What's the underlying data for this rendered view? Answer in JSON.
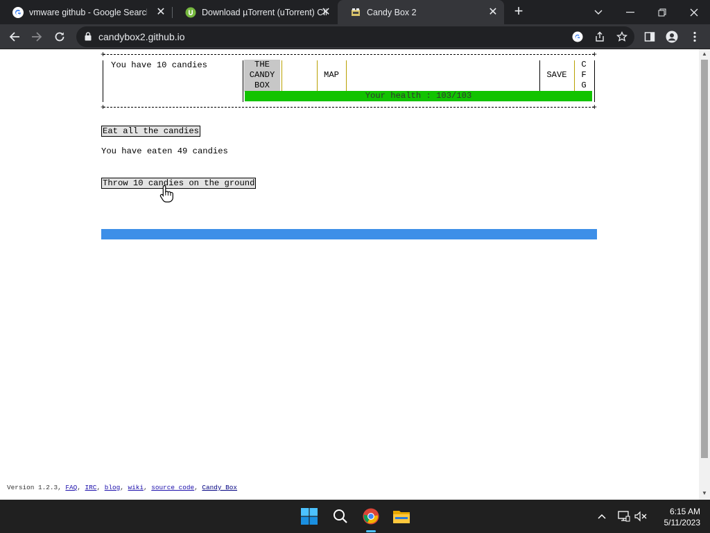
{
  "browser": {
    "tabs": [
      {
        "title": "vmware github - Google Search",
        "icon": "google-icon"
      },
      {
        "title": "Download µTorrent (uTorrent) Cli",
        "icon": "utorrent-icon"
      },
      {
        "title": "Candy Box 2",
        "icon": "candybox-icon"
      }
    ],
    "active_tab": 2,
    "new_tab": "+",
    "url": "candybox2.github.io"
  },
  "game": {
    "candies_text": "You have 10 candies",
    "menu": {
      "candy_box": [
        "THE",
        "CANDY",
        "BOX"
      ],
      "map": "MAP",
      "save": "SAVE",
      "cfg": [
        "C",
        "F",
        "G"
      ]
    },
    "health_text": "Your health : 103/103",
    "eat_button": "Eat all the candies",
    "eaten_text": "You have eaten 49 candies",
    "throw_button": "Throw 10 candies on the ground"
  },
  "footer": {
    "version": "Version 1.2.3, ",
    "links": [
      "FAQ",
      "IRC",
      "blog",
      "wiki",
      "source code",
      "Candy Box"
    ]
  },
  "taskbar": {
    "time": "6:15 AM",
    "date": "5/11/2023"
  },
  "colors": {
    "health_bar": "#12c300",
    "blue_bar": "#3d8fe8",
    "candy_box_bg": "#c7c7c7"
  }
}
